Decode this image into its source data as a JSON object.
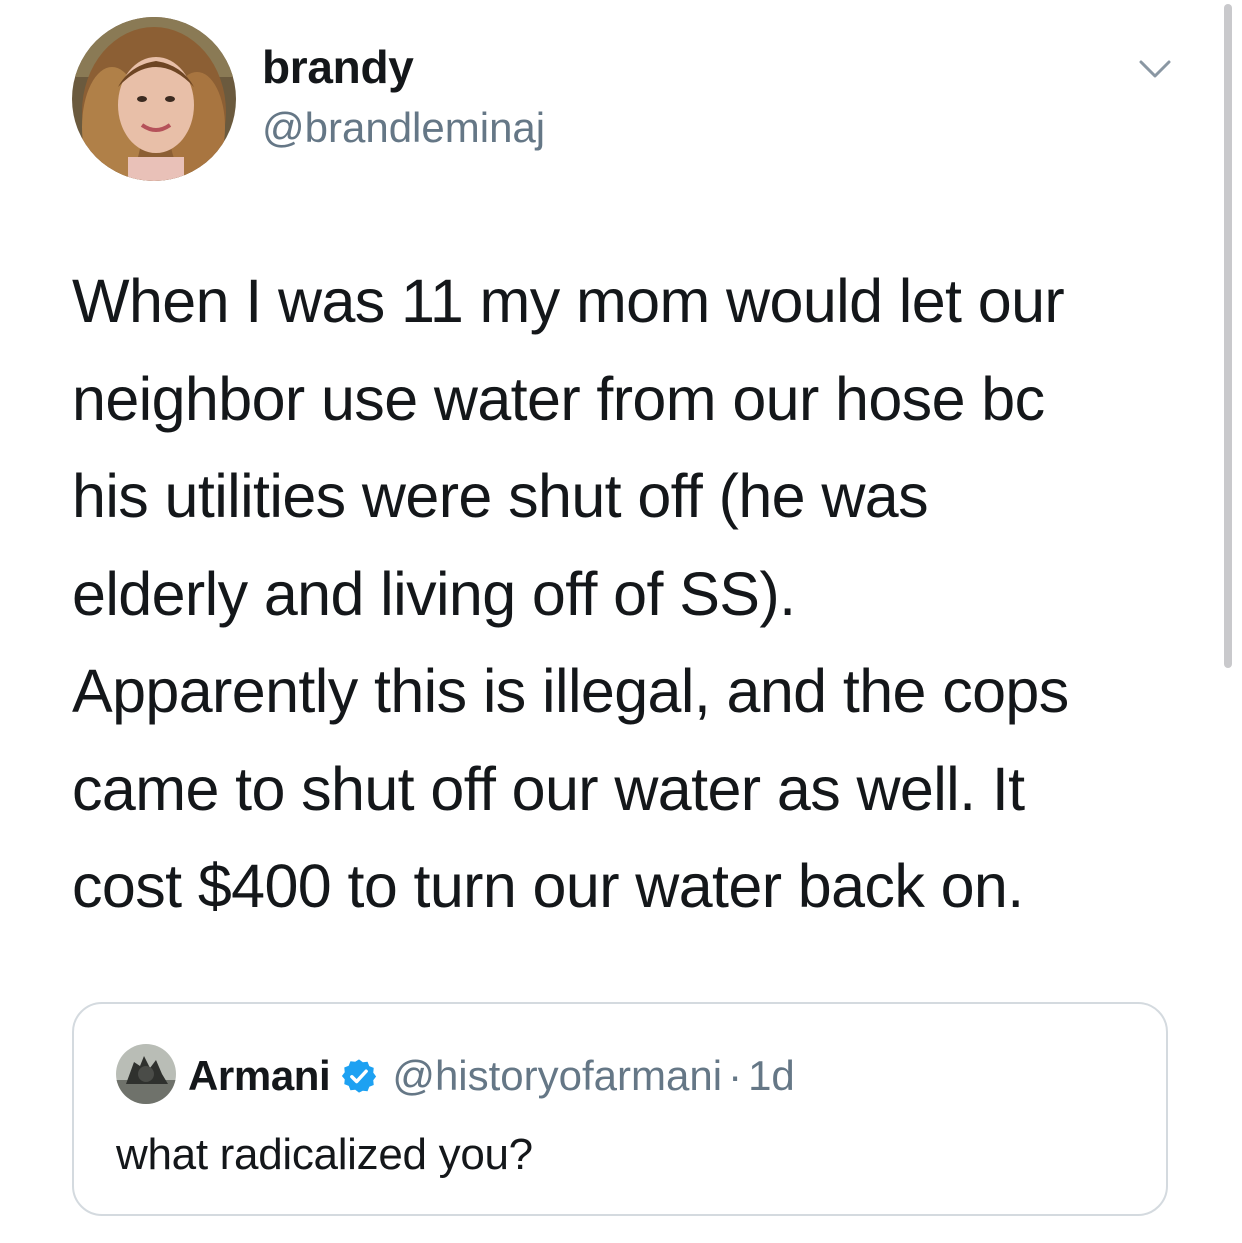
{
  "tweet": {
    "author": {
      "display_name": "brandy",
      "handle": "@brandleminaj"
    },
    "text": "When I was 11 my mom would let our\nneighbor use water from our hose bc\nhis utilities were shut off (he was\nelderly and living off of SS).\nApparently this is illegal, and the cops\ncame to shut off our water as well. It\ncost $400 to turn our water back on."
  },
  "quoted_tweet": {
    "author": {
      "display_name": "Armani",
      "handle": "@historyofarmani",
      "verified": true
    },
    "separator": "·",
    "time": "1d",
    "text": "what radicalized you?"
  },
  "icons": {
    "menu": "chevron-down-icon",
    "verified": "verified-badge-icon"
  },
  "colors": {
    "text_primary": "#14171a",
    "text_secondary": "#657786",
    "verified_blue": "#1da1f2",
    "card_border": "#d4dadf"
  }
}
